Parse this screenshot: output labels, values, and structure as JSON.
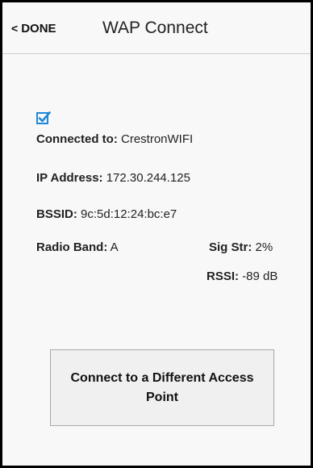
{
  "header": {
    "done_chevron": "<",
    "done_label": "DONE",
    "title": "WAP Connect"
  },
  "status": {
    "checked": true,
    "check_color": "#1e88d6",
    "connected_label": "Connected to:",
    "connected_value": " CrestronWIFI",
    "ip_label": "IP Address:",
    "ip_value": " 172.30.244.125",
    "bssid_label": "BSSID:",
    "bssid_value": " 9c:5d:12:24:bc:e7",
    "radio_label": "Radio Band:",
    "radio_value": " A",
    "sig_label": "Sig Str:",
    "sig_value": " 2%",
    "rssi_label": "RSSI:",
    "rssi_value": " -89 dB"
  },
  "action": {
    "connect_label": "Connect to a Different Access Point"
  }
}
